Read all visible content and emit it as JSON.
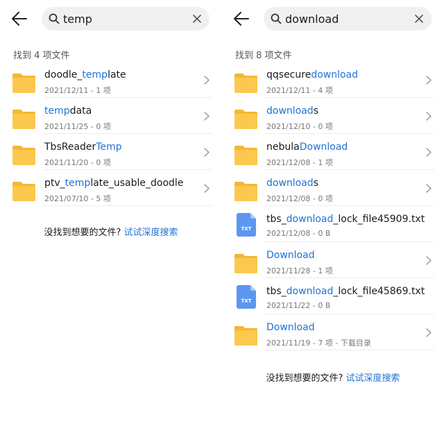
{
  "colors": {
    "accent": "#1d72d8",
    "folder": "#fcc84e",
    "txt_file": "#5b97f0"
  },
  "left": {
    "search": {
      "query": "temp"
    },
    "summary": "找到 4 项文件",
    "rows": [
      {
        "type": "folder",
        "name": [
          {
            "t": "doodle_",
            "hl": false
          },
          {
            "t": "temp",
            "hl": true
          },
          {
            "t": "late",
            "hl": false
          }
        ],
        "meta": "2021/12/11 - 1 项"
      },
      {
        "type": "folder",
        "name": [
          {
            "t": "temp",
            "hl": true
          },
          {
            "t": "data",
            "hl": false
          }
        ],
        "meta": "2021/11/25 - 0 项"
      },
      {
        "type": "folder",
        "name": [
          {
            "t": "TbsReader",
            "hl": false
          },
          {
            "t": "Temp",
            "hl": true
          }
        ],
        "meta": "2021/11/20 - 0 项"
      },
      {
        "type": "folder",
        "name": [
          {
            "t": "ptv_",
            "hl": false
          },
          {
            "t": "temp",
            "hl": true
          },
          {
            "t": "late_usable_doodle",
            "hl": false
          }
        ],
        "meta": "2021/07/10 - 5 项"
      }
    ],
    "footer": {
      "text": "没找到想要的文件? ",
      "link": "试试深度搜索"
    }
  },
  "right": {
    "search": {
      "query": "download"
    },
    "summary": "找到 8 项文件",
    "rows": [
      {
        "type": "folder",
        "name": [
          {
            "t": "qqsecure",
            "hl": false
          },
          {
            "t": "download",
            "hl": true
          }
        ],
        "meta": "2021/12/11 - 4 项"
      },
      {
        "type": "folder",
        "name": [
          {
            "t": "download",
            "hl": true
          },
          {
            "t": "s",
            "hl": false
          }
        ],
        "meta": "2021/12/10 - 0 项"
      },
      {
        "type": "folder",
        "name": [
          {
            "t": "nebula",
            "hl": false
          },
          {
            "t": "Download",
            "hl": true
          }
        ],
        "meta": "2021/12/08 - 1 项"
      },
      {
        "type": "folder",
        "name": [
          {
            "t": "download",
            "hl": true
          },
          {
            "t": "s",
            "hl": false
          }
        ],
        "meta": "2021/12/08 - 0 项"
      },
      {
        "type": "txt",
        "icon_label": "TXT",
        "name": [
          {
            "t": "tbs_",
            "hl": false
          },
          {
            "t": "download",
            "hl": true
          },
          {
            "t": "_lock_file45909.txt",
            "hl": false
          }
        ],
        "meta": "2021/12/08 - 0 B"
      },
      {
        "type": "folder",
        "name": [
          {
            "t": "Download",
            "hl": true
          }
        ],
        "meta": "2021/11/28 - 1 项"
      },
      {
        "type": "txt",
        "icon_label": "TXT",
        "name": [
          {
            "t": "tbs_",
            "hl": false
          },
          {
            "t": "download",
            "hl": true
          },
          {
            "t": "_lock_file45869.txt",
            "hl": false
          }
        ],
        "meta": "2021/11/22 - 0 B"
      },
      {
        "type": "folder",
        "name": [
          {
            "t": "Download",
            "hl": true
          }
        ],
        "meta": "2021/11/19 - 7 项 - 下载目录"
      }
    ],
    "footer": {
      "text": "没找到想要的文件? ",
      "link": "试试深度搜索"
    }
  }
}
